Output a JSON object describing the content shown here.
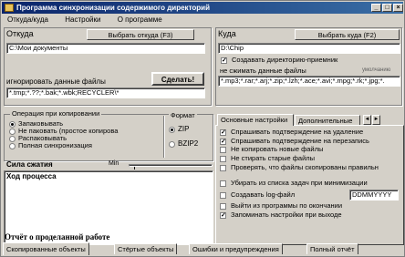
{
  "window": {
    "title": "Программа синхронизации содержимого директорий"
  },
  "menu": [
    "Откуда/куда",
    "Настройки",
    "О программе"
  ],
  "source": {
    "heading": "Откуда",
    "browse_label": "Выбрать откуда (F3)",
    "path": "C:\\Мои документы",
    "ignore_label": "игнорировать данные файлы",
    "ignore_value": "*.tmp;*.??;*.bak;*.wbk;RECYCLER\\*"
  },
  "run_button": "Сделать!",
  "dest": {
    "heading": "Куда",
    "browse_label": "Выбрать куда (F2)",
    "path": "D:\\Chip",
    "create_dir_label": "Создавать директорию-приемник",
    "no_compress_label": "не сжимать данные файлы",
    "default_label": "умолчанию",
    "no_compress_value": "*.mp3;*.rar;*.arj;*.zip;*.lzh;*.ace;*.avi;*.mpg;*.rk;*.jpg;*."
  },
  "copy_operation": {
    "title": "Операция при копировании",
    "options": [
      "Запаковывать",
      "Не паковать (простое копирова",
      "Распаковывать",
      "Полная синхронизация"
    ],
    "selected": 0
  },
  "format": {
    "title": "Формат",
    "options": [
      "ZIP",
      "BZIP2"
    ],
    "selected": 0
  },
  "compression": {
    "label": "Сила сжатия",
    "min_label": "Min"
  },
  "progress": {
    "label": "Ход процесса"
  },
  "settings_tabs": [
    "Основные настройки",
    "Дополнительные"
  ],
  "settings": [
    {
      "label": "Спрашивать подтверждение на удаление",
      "checked": true
    },
    {
      "label": "Спрашивать подтверждение на перезапись",
      "checked": true
    },
    {
      "label": "Не копировать новые файлы",
      "checked": false
    },
    {
      "label": "Не стирать старые файлы",
      "checked": false
    },
    {
      "label": "Проверять, что файлы скопированы правильн",
      "checked": false
    },
    {
      "label": "Убирать из списка задач при минимизации",
      "checked": false
    },
    {
      "label": "Создавать log-файл",
      "checked": false
    },
    {
      "label": "Выйти из программы по окончании",
      "checked": false
    },
    {
      "label": "Запоминать настройки при выходе",
      "checked": true
    }
  ],
  "log_date_format": "DDMMYYYY",
  "report": {
    "title": "Отчёт о проделанной работе",
    "tabs": [
      "Скопированные объекты",
      "Стёртые объекты",
      "Ошибки и предупреждения",
      "Полный отчёт"
    ]
  }
}
